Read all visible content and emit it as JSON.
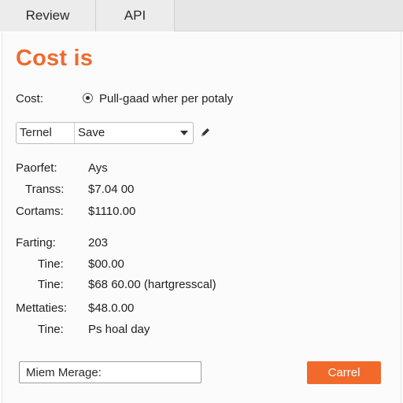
{
  "tabs": [
    {
      "label": "Review"
    },
    {
      "label": "API"
    }
  ],
  "title": "Cost is",
  "colors": {
    "accent": "#ef6a2e",
    "button": "#f26a2b"
  },
  "cost": {
    "label": "Cost:",
    "radio_label": "Pull-gaad wher per potaly",
    "radio_selected": true
  },
  "select": {
    "left_label": "Ternel",
    "value": "Save",
    "caret_icon": "chevron-down-icon",
    "edit_icon": "pencil-icon"
  },
  "details": [
    {
      "label": "Paorfet:",
      "value": "Ays"
    },
    {
      "label": "Transs:",
      "value": "$7.04 00"
    },
    {
      "label": "Cortams:",
      "value": "$1110.00"
    },
    {
      "label": "Farting:",
      "value": "203"
    },
    {
      "label": "Tine:",
      "value": "$00.00"
    },
    {
      "label": "Tine:",
      "value": "$68 60.00 (hartgresscal)"
    },
    {
      "label": "Mettaties:",
      "value": "$48.0.00"
    },
    {
      "label": "Tine:",
      "value": "Ps hoal day"
    }
  ],
  "message": {
    "placeholder": "Miem Merage:"
  },
  "cancel_button": {
    "label": "Carrel"
  }
}
